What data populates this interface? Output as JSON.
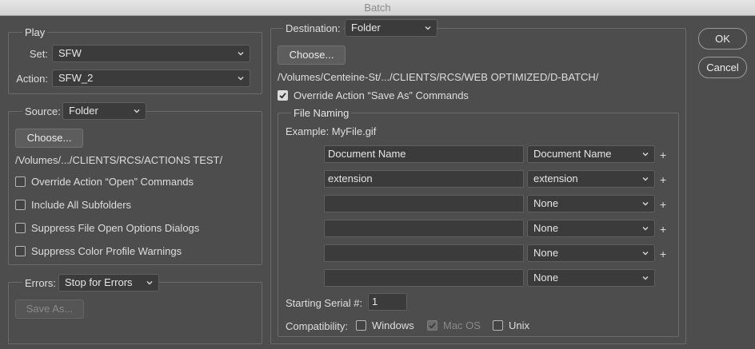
{
  "window": {
    "title": "Batch"
  },
  "play": {
    "legend": "Play",
    "set_label": "Set:",
    "set_value": "SFW",
    "action_label": "Action:",
    "action_value": "SFW_2"
  },
  "source": {
    "label": "Source:",
    "value": "Folder",
    "choose_label": "Choose...",
    "path": "/Volumes/.../CLIENTS/RCS/ACTIONS TEST/",
    "options": [
      {
        "label": "Override Action “Open” Commands",
        "checked": false
      },
      {
        "label": "Include All Subfolders",
        "checked": false
      },
      {
        "label": "Suppress File Open Options Dialogs",
        "checked": false
      },
      {
        "label": "Suppress Color Profile Warnings",
        "checked": false
      }
    ]
  },
  "errors": {
    "label": "Errors:",
    "value": "Stop for Errors",
    "save_as_label": "Save As..."
  },
  "destination": {
    "label": "Destination:",
    "value": "Folder",
    "choose_label": "Choose...",
    "path": "/Volumes/Centeine-St/.../CLIENTS/RCS/WEB OPTIMIZED/D-BATCH/",
    "override_label": "Override Action “Save As” Commands",
    "override_checked": true
  },
  "file_naming": {
    "legend": "File Naming",
    "example": "Example: MyFile.gif",
    "rows": [
      {
        "text": "Document Name",
        "select": "Document Name",
        "plus": "+"
      },
      {
        "text": "extension",
        "select": "extension",
        "plus": "+"
      },
      {
        "text": "",
        "select": "None",
        "plus": "+"
      },
      {
        "text": "",
        "select": "None",
        "plus": "+"
      },
      {
        "text": "",
        "select": "None",
        "plus": "+"
      },
      {
        "text": "",
        "select": "None",
        "plus": ""
      }
    ],
    "serial_label": "Starting Serial #:",
    "serial_value": "1",
    "compat_label": "Compatibility:",
    "compat": [
      {
        "label": "Windows",
        "checked": false,
        "disabled": false
      },
      {
        "label": "Mac OS",
        "checked": true,
        "disabled": true
      },
      {
        "label": "Unix",
        "checked": false,
        "disabled": false
      }
    ]
  },
  "buttons": {
    "ok": "OK",
    "cancel": "Cancel"
  },
  "icons": {
    "dropdown": "chevron-updown-icon",
    "check": "checkmark-icon"
  }
}
